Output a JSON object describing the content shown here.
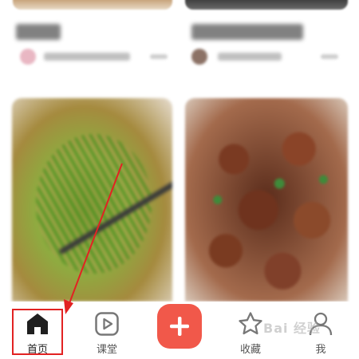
{
  "tabbar": {
    "home": {
      "label": "首页",
      "icon": "home-icon"
    },
    "class": {
      "label": "课堂",
      "icon": "play-icon"
    },
    "add": {
      "icon": "plus-icon"
    },
    "favorites": {
      "label": "收藏",
      "icon": "star-icon"
    },
    "me": {
      "label": "我",
      "icon": "user-icon"
    }
  },
  "colors": {
    "accent": "#f1584a",
    "annotation": "#e22222",
    "tab_text": "#555555"
  },
  "watermark": "Bai 经验"
}
